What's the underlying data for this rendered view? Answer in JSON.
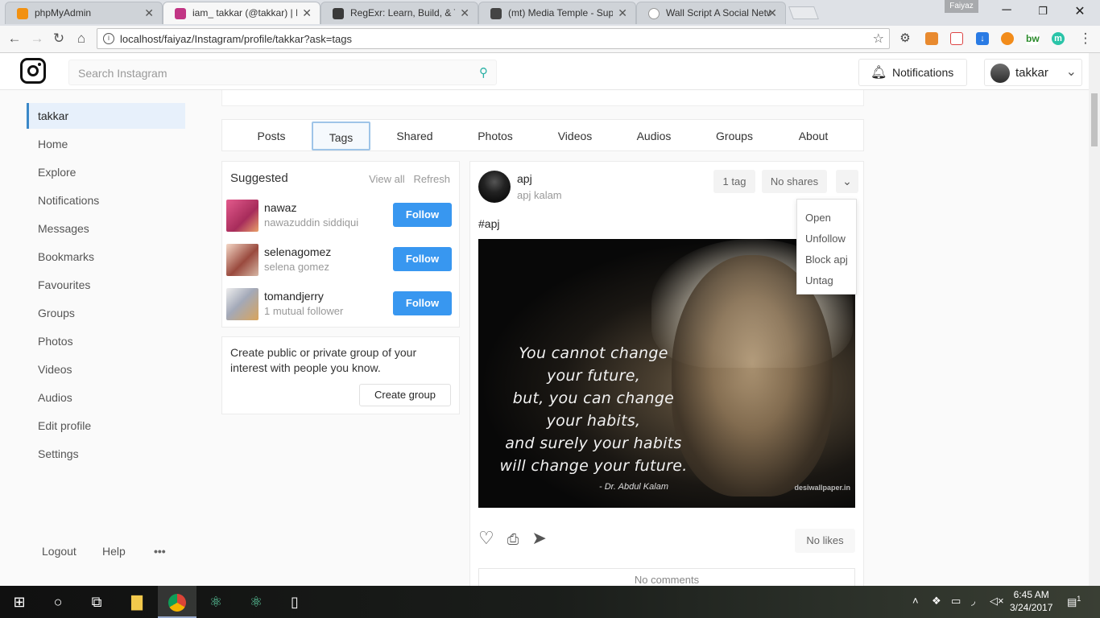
{
  "browser": {
    "tabs": [
      {
        "title": "phpMyAdmin",
        "favicon_color": "#f29111"
      },
      {
        "title": "iam_ takkar (@takkar) | In",
        "favicon_color": "#c13584"
      },
      {
        "title": "RegExr: Learn, Build, & Te",
        "favicon_color": "#3a3a3a"
      },
      {
        "title": "(mt) Media Temple - Sup",
        "favicon_color": "#444444"
      },
      {
        "title": "Wall Script A Social Netw",
        "favicon_color": "#dddddd"
      }
    ],
    "profile_name": "Faiyaz",
    "url": "localhost/faiyaz/Instagram/profile/takkar?ask=tags"
  },
  "header": {
    "search_placeholder": "Search Instagram",
    "notifications_label": "Notifications",
    "username": "takkar"
  },
  "sidebar": {
    "items": [
      {
        "label": "takkar"
      },
      {
        "label": "Home"
      },
      {
        "label": "Explore"
      },
      {
        "label": "Notifications"
      },
      {
        "label": "Messages"
      },
      {
        "label": "Bookmarks"
      },
      {
        "label": "Favourites"
      },
      {
        "label": "Groups"
      },
      {
        "label": "Photos"
      },
      {
        "label": "Videos"
      },
      {
        "label": "Audios"
      },
      {
        "label": "Edit profile"
      },
      {
        "label": "Settings"
      }
    ],
    "footer": {
      "logout": "Logout",
      "help": "Help",
      "more": "•••"
    }
  },
  "profile_tabs": [
    "Posts",
    "Tags",
    "Shared",
    "Photos",
    "Videos",
    "Audios",
    "Groups",
    "About"
  ],
  "suggested": {
    "title": "Suggested",
    "view_all": "View all",
    "refresh": "Refresh",
    "users": [
      {
        "username": "nawaz",
        "subtitle": "nawazuddin siddiqui",
        "button": "Follow",
        "avatar_color": "#c7447a"
      },
      {
        "username": "selenagomez",
        "subtitle": "selena gomez",
        "button": "Follow",
        "avatar_color": "#b5655a"
      },
      {
        "username": "tomandjerry",
        "subtitle": "1 mutual follower",
        "button": "Follow",
        "avatar_color": "#b89a6a"
      }
    ]
  },
  "group_card": {
    "text": "Create public or private group of your interest with people you know.",
    "button": "Create group"
  },
  "post": {
    "username": "apj",
    "fullname": "apj kalam",
    "tags_pill": "1 tag",
    "shares_pill": "No shares",
    "caption": "#apj",
    "quote_lines": [
      "You cannot change",
      "your future,",
      "but, you can change",
      "your habits,",
      "and surely your habits",
      "will change your future."
    ],
    "quote_attribution": "- Dr. Abdul Kalam",
    "watermark": "desiwallpaper.in",
    "likes": "No likes",
    "comments": "No comments"
  },
  "post_menu": [
    "Open",
    "Unfollow",
    "Block apj",
    "Untag"
  ],
  "taskbar": {
    "time": "6:45 AM",
    "date": "3/24/2017",
    "notif_count": "1"
  }
}
